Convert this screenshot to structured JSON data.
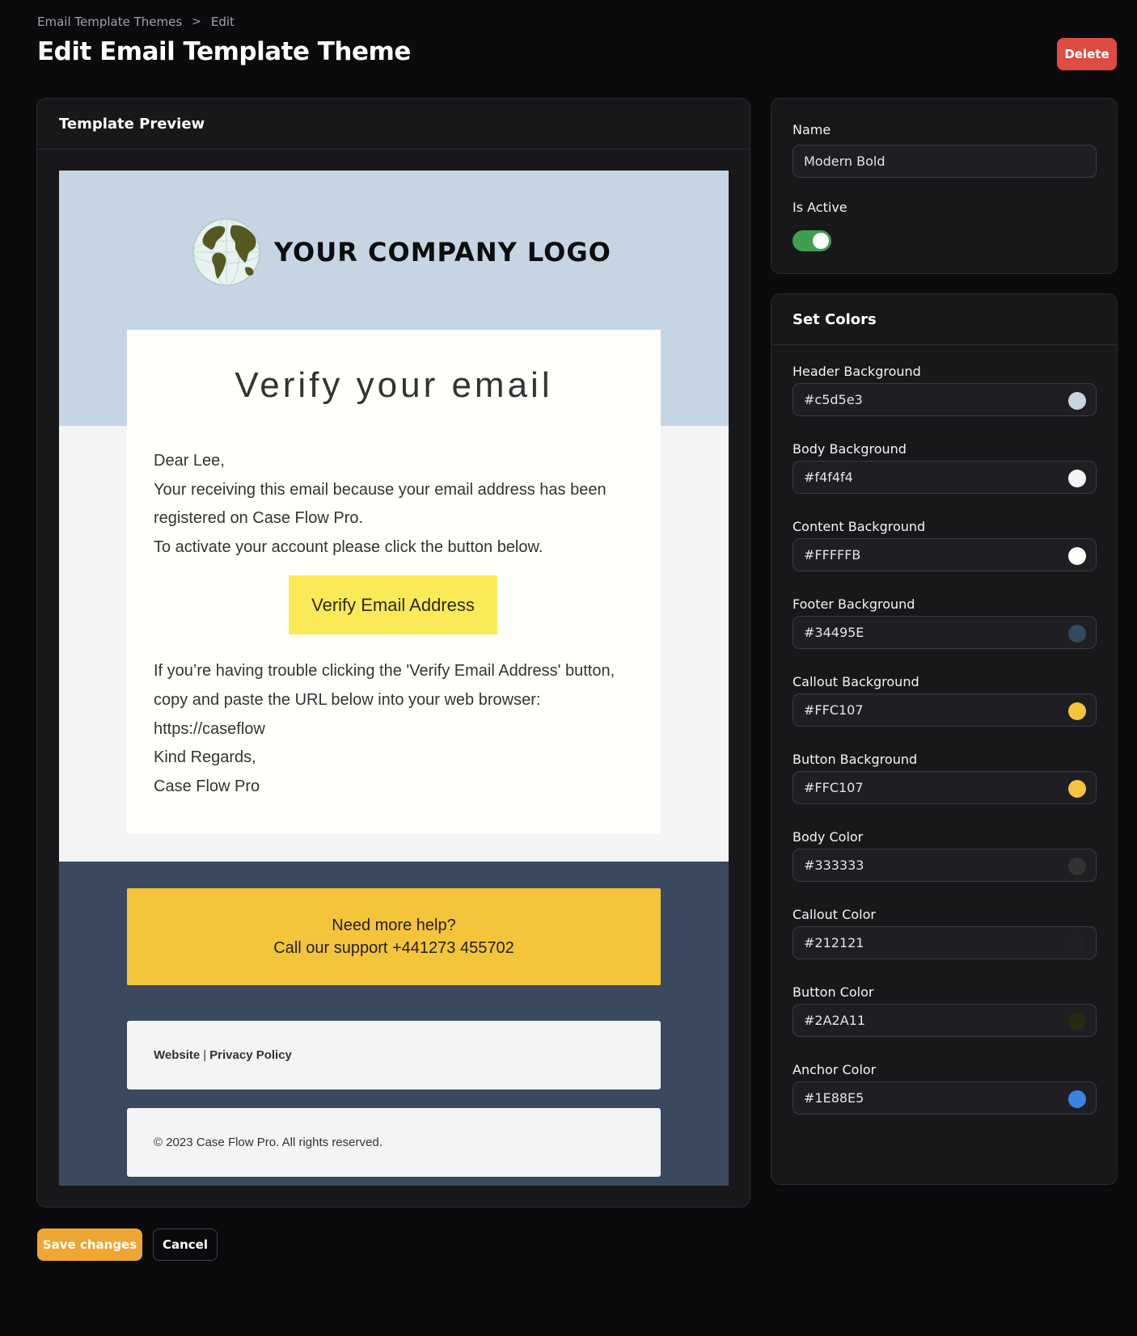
{
  "breadcrumb": {
    "parent": "Email Template Themes",
    "separator": ">",
    "current": "Edit"
  },
  "page_title": "Edit Email Template Theme",
  "delete_label": "Delete",
  "preview": {
    "panel_title": "Template Preview",
    "logo_text": "YOUR COMPANY LOGO",
    "logo_icon": "globe-icon",
    "headline": "Verify your email",
    "body_lines": [
      "Dear Lee,",
      "Your receiving this email because your email address has been",
      "registered on Case Flow Pro.",
      "To activate your account please click the button below."
    ],
    "cta_label": "Verify Email Address",
    "trouble_lines": [
      "If you’re having trouble clicking the 'Verify Email Address' button,",
      "copy and paste the URL below into your web browser:",
      "https://caseflow",
      "Kind Regards,",
      "Case Flow Pro"
    ],
    "callout_line1": "Need more help?",
    "callout_line2": "Call our support +441273 455702",
    "footer_link_website": "Website",
    "footer_link_separator": "|",
    "footer_link_privacy": "Privacy Policy",
    "copyright": "© 2023 Case Flow Pro. All rights reserved."
  },
  "settings": {
    "name_label": "Name",
    "name_value": "Modern Bold",
    "active_label": "Is Active",
    "is_active": true
  },
  "colors": {
    "panel_title": "Set Colors",
    "fields": [
      {
        "label": "Header Background",
        "value": "#c5d5e3",
        "swatch": "#c5d5e3"
      },
      {
        "label": "Body Background",
        "value": "#f4f4f4",
        "swatch": "#f4f4f4"
      },
      {
        "label": "Content Background",
        "value": "#FFFFFB",
        "swatch": "#fffffb"
      },
      {
        "label": "Footer Background",
        "value": "#34495E",
        "swatch": "#34495e"
      },
      {
        "label": "Callout Background",
        "value": "#FFC107",
        "swatch": "#f4c43b"
      },
      {
        "label": "Button Background",
        "value": "#FFC107",
        "swatch": "#f4c43b"
      },
      {
        "label": "Body Color",
        "value": "#333333",
        "swatch": "#333333"
      },
      {
        "label": "Callout Color",
        "value": "#212121",
        "swatch": "#212121"
      },
      {
        "label": "Button Color",
        "value": "#2A2A11",
        "swatch": "#2a2a11"
      },
      {
        "label": "Anchor Color",
        "value": "#1E88E5",
        "swatch": "#3b82e5"
      }
    ]
  },
  "actions": {
    "save_label": "Save changes",
    "cancel_label": "Cancel"
  }
}
